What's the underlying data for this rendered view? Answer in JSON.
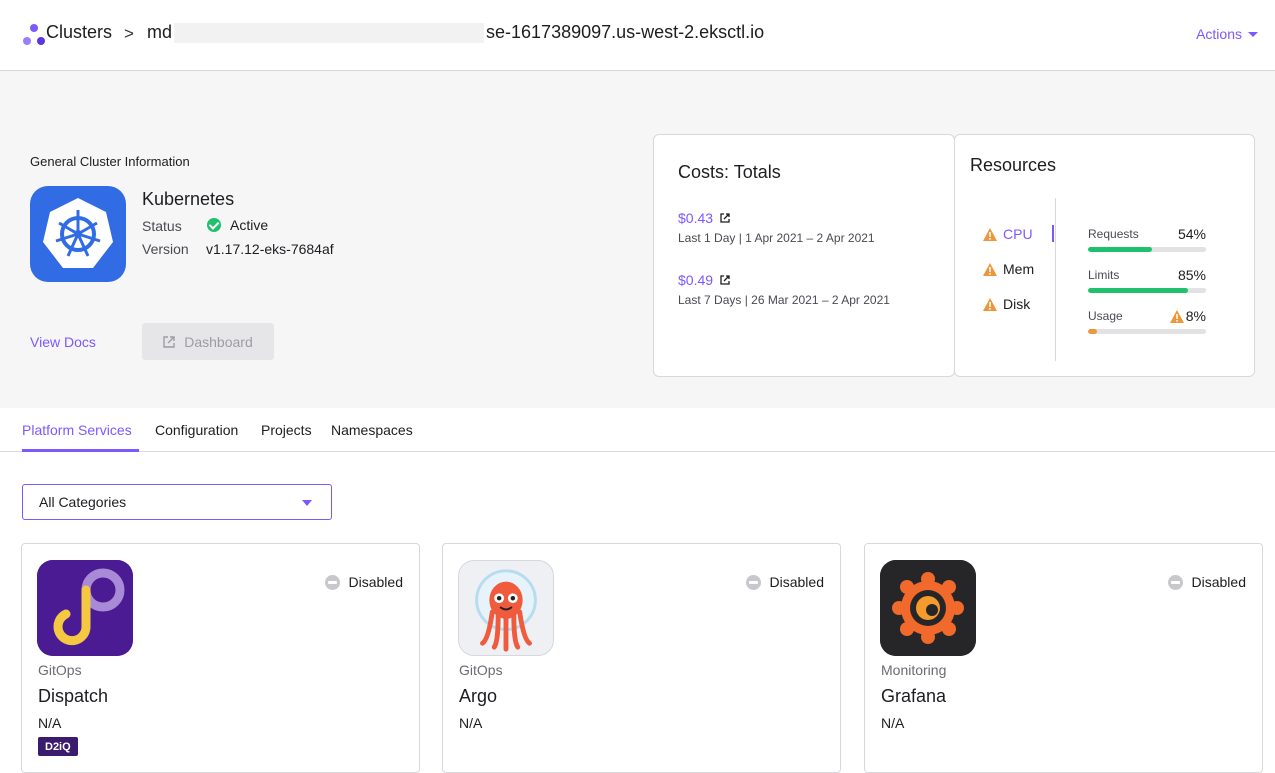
{
  "header": {
    "root_crumb": "Clusters",
    "separator": ">",
    "cluster_prefix": "md",
    "cluster_suffix": "se-1617389097.us-west-2.eksctl.io",
    "actions_label": "Actions"
  },
  "general": {
    "section_title": "General Cluster Information",
    "name": "Kubernetes",
    "status_label": "Status",
    "status_value": "Active",
    "version_label": "Version",
    "version_value": "v1.17.12-eks-7684af",
    "view_docs": "View Docs",
    "dashboard": "Dashboard"
  },
  "costs": {
    "title": "Costs: Totals",
    "items": [
      {
        "amount": "$0.43",
        "period": "Last 1 Day | 1 Apr 2021 – 2 Apr 2021"
      },
      {
        "amount": "$0.49",
        "period": "Last 7 Days | 26 Mar 2021 – 2 Apr 2021"
      }
    ]
  },
  "resources": {
    "title": "Resources",
    "items": [
      {
        "label": "CPU",
        "warning": true,
        "active": true
      },
      {
        "label": "Mem",
        "warning": true,
        "active": false
      },
      {
        "label": "Disk",
        "warning": true,
        "active": false
      }
    ],
    "meters": [
      {
        "label": "Requests",
        "value": "54%",
        "fraction": 0.54,
        "color": "#1fc06e",
        "warning": false
      },
      {
        "label": "Limits",
        "value": "85%",
        "fraction": 0.85,
        "color": "#1fc06e",
        "warning": false
      },
      {
        "label": "Usage",
        "value": "8%",
        "fraction": 0.08,
        "color": "#f0963a",
        "warning": true
      }
    ]
  },
  "tabs": [
    {
      "label": "Platform Services",
      "active": true
    },
    {
      "label": "Configuration",
      "active": false
    },
    {
      "label": "Projects",
      "active": false
    },
    {
      "label": "Namespaces",
      "active": false
    }
  ],
  "filter": {
    "selected": "All Categories"
  },
  "services": [
    {
      "category": "GitOps",
      "name": "Dispatch",
      "version": "N/A",
      "status": "Disabled",
      "badge": "D2iQ",
      "icon": "dispatch-logo"
    },
    {
      "category": "GitOps",
      "name": "Argo",
      "version": "N/A",
      "status": "Disabled",
      "badge": "",
      "icon": "argo-logo"
    },
    {
      "category": "Monitoring",
      "name": "Grafana",
      "version": "N/A",
      "status": "Disabled",
      "badge": "",
      "icon": "grafana-logo"
    }
  ],
  "colors": {
    "accent": "#7d58ff",
    "success": "#1fc06e",
    "warning": "#f0963a",
    "k8s_blue": "#326ce5"
  }
}
